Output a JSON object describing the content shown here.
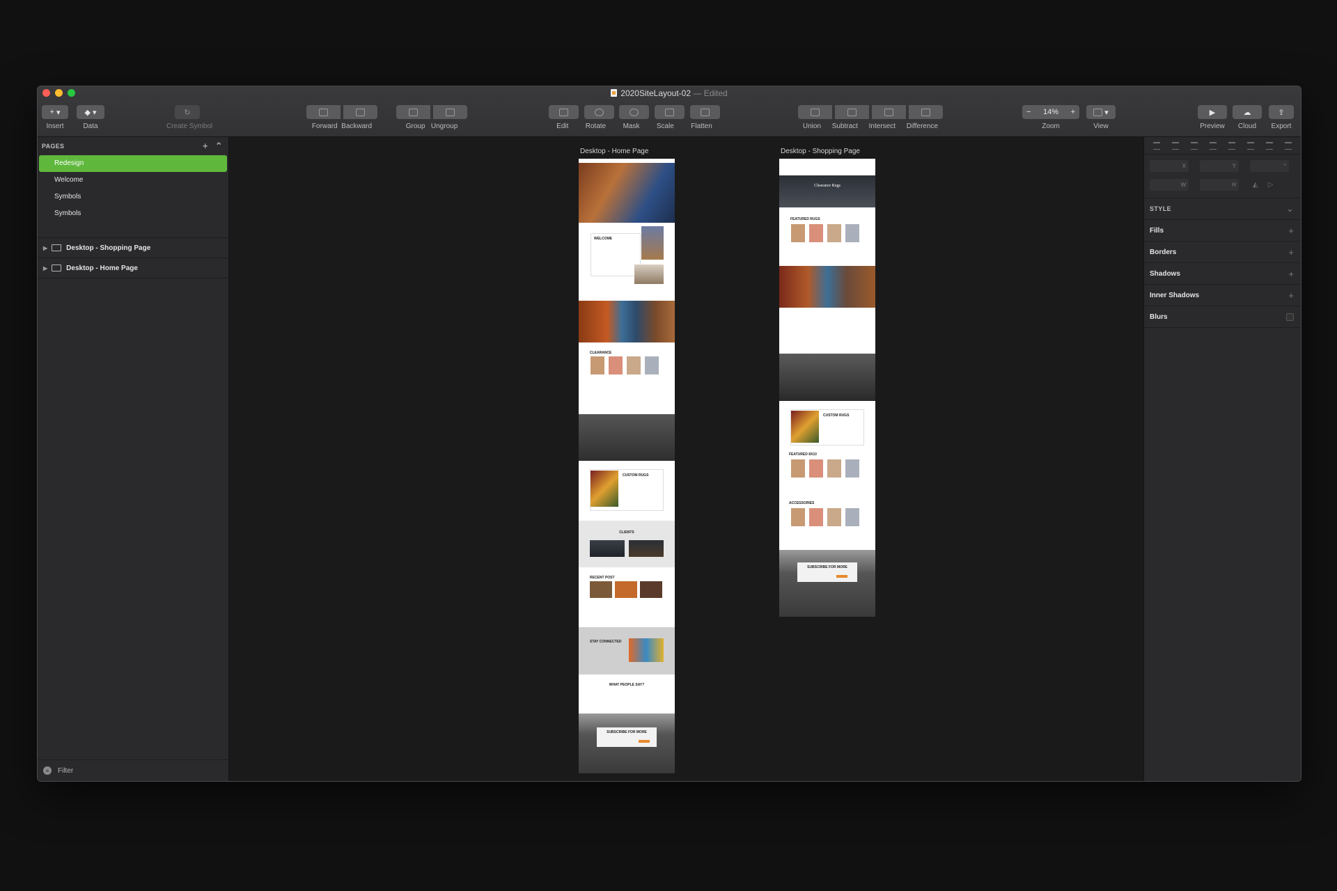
{
  "window": {
    "title": "2020SiteLayout-02",
    "title_suffix": "— Edited"
  },
  "toolbar": {
    "insert": {
      "label": "Insert",
      "glyph": "+"
    },
    "data": {
      "label": "Data"
    },
    "create_symbol": {
      "label": "Create Symbol"
    },
    "forward": {
      "label": "Forward"
    },
    "backward": {
      "label": "Backward"
    },
    "group": {
      "label": "Group"
    },
    "ungroup": {
      "label": "Ungroup"
    },
    "edit": {
      "label": "Edit"
    },
    "rotate": {
      "label": "Rotate"
    },
    "mask": {
      "label": "Mask"
    },
    "scale": {
      "label": "Scale"
    },
    "flatten": {
      "label": "Flatten"
    },
    "union": {
      "label": "Union"
    },
    "subtract": {
      "label": "Subtract"
    },
    "intersect": {
      "label": "Intersect"
    },
    "difference": {
      "label": "Difference"
    },
    "zoom": {
      "label": "Zoom",
      "value": "14%",
      "minus": "−",
      "plus": "+"
    },
    "view": {
      "label": "View"
    },
    "preview": {
      "label": "Preview"
    },
    "cloud": {
      "label": "Cloud"
    },
    "export": {
      "label": "Export"
    }
  },
  "pages_panel": {
    "header": "PAGES",
    "add_glyph": "+",
    "collapse_glyph": "⌃",
    "pages": [
      {
        "label": "Redesign",
        "active": true
      },
      {
        "label": "Welcome"
      },
      {
        "label": "Symbols"
      },
      {
        "label": "Symbols"
      }
    ],
    "layers": [
      {
        "label": "Desktop - Shopping Page"
      },
      {
        "label": "Desktop - Home Page"
      }
    ],
    "filter_label": "Filter"
  },
  "canvas": {
    "artboards": [
      {
        "label": "Desktop - Home Page"
      },
      {
        "label": "Desktop - Shopping Page"
      }
    ],
    "home": {
      "welcome": "WELCOME",
      "clearance": "CLEARANCE",
      "custom_rugs": "CUSTOM RUGS",
      "clients": "CLIENTS",
      "recent_post": "RECENT POST",
      "stay_connected": "STAY CONNECTED",
      "what_people_say": "WHAT PEOPLE SAY?",
      "subscribe": "SUBSCRIBE FOR MORE"
    },
    "shopping": {
      "hero_title": "Clearance Rugs",
      "featured_rugs": "FEATURED RUGS",
      "custom_rugs": "CUSTOM RUGS",
      "featured_8x10": "FEATURED 8X10",
      "accessories": "ACCESSORIES",
      "subscribe": "SUBSCRIBE FOR MORE"
    }
  },
  "inspector": {
    "fields": {
      "x": "X",
      "y": "Y",
      "rotation": "°",
      "w": "W",
      "h": "H"
    },
    "style_header": "STYLE",
    "sections": [
      {
        "label": "Fills",
        "action": "+"
      },
      {
        "label": "Borders",
        "action": "+"
      },
      {
        "label": "Shadows",
        "action": "+"
      },
      {
        "label": "Inner Shadows",
        "action": "+"
      },
      {
        "label": "Blurs"
      }
    ]
  },
  "colors": {
    "active_page": "#5fb83c",
    "close": "#ff5f57",
    "minimize": "#febc2e",
    "zoom": "#28c840",
    "accent_orange": "#e8892b"
  }
}
